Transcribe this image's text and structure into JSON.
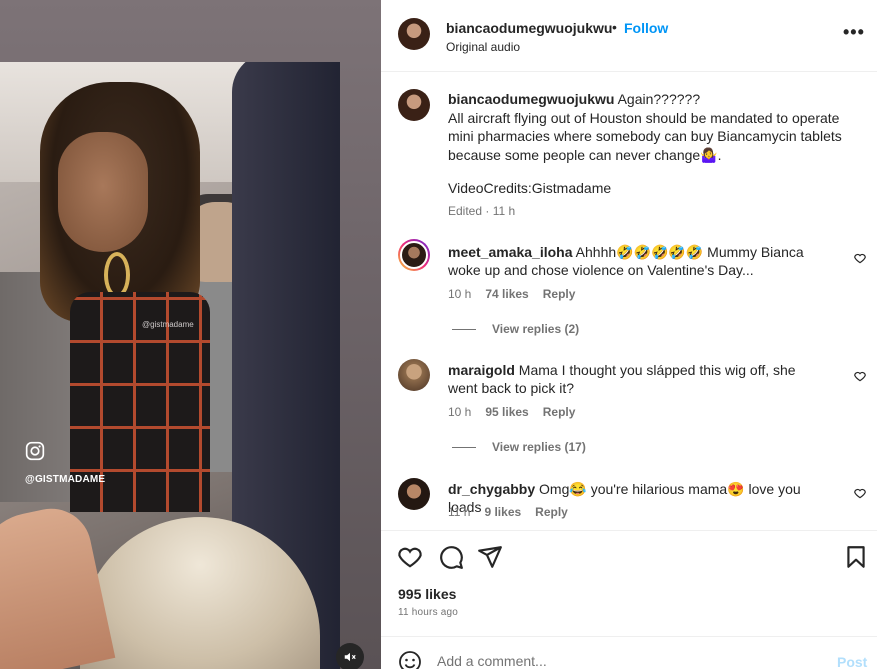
{
  "media": {
    "watermark": "@gistmadame",
    "handle": "@GISTMADAME"
  },
  "header": {
    "username": "biancaodumegwuojukwu",
    "separator": "•",
    "follow_label": "Follow",
    "subtitle": "Original audio",
    "more_label": "•••"
  },
  "caption": {
    "username": "biancaodumegwuojukwu",
    "text": "Again??????\nAll aircraft flying out of Houston should be mandated to operate mini pharmacies where somebody can buy Biancamycin tablets because some people can never change🤷‍♀️.",
    "credits": "VideoCredits:Gistmadame",
    "meta": "Edited · 11 h"
  },
  "comments": [
    {
      "username": "meet_amaka_iloha",
      "text": "Ahhhh🤣🤣🤣🤣🤣 Mummy Bianca woke up and chose violence on Valentine's Day...",
      "time": "10 h",
      "likes": "74 likes",
      "reply": "Reply",
      "view_replies": "View replies (2)"
    },
    {
      "username": "maraigold",
      "text": "Mama I thought you slápped this wig off, she went back to pick it?",
      "time": "10 h",
      "likes": "95 likes",
      "reply": "Reply",
      "view_replies": "View replies (17)"
    },
    {
      "username": "dr_chygabby",
      "text": "Omg😂 you're hilarious mama😍 love you loads",
      "time": "11 h",
      "likes": "9 likes",
      "reply": "Reply"
    }
  ],
  "post": {
    "likes": "995 likes",
    "time_ago": "11 hours ago"
  },
  "add_comment": {
    "placeholder": "Add a comment...",
    "post_label": "Post"
  },
  "colors": {
    "link_blue": "#0095f6",
    "muted_text": "#737373",
    "post_disabled": "#b2dffc"
  }
}
